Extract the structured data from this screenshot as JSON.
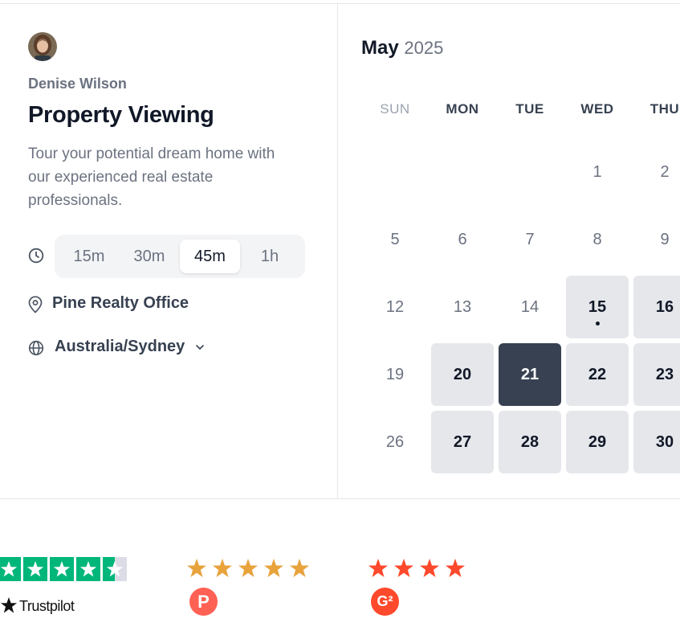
{
  "host": {
    "name": "Denise Wilson"
  },
  "event": {
    "title": "Property Viewing",
    "description": "Tour your potential dream home with our experienced real estate professionals."
  },
  "durations": {
    "options": [
      "15m",
      "30m",
      "45m",
      "1h"
    ],
    "selected": "45m"
  },
  "location": {
    "label": "Pine Realty Office"
  },
  "timezone": {
    "label": "Australia/Sydney"
  },
  "calendar": {
    "month": "May",
    "year": "2025",
    "weekdays": [
      "SUN",
      "MON",
      "TUE",
      "WED",
      "THU"
    ],
    "selected_day": "21",
    "today": "15"
  },
  "reviews": {
    "trustpilot": {
      "name": "Trustpilot",
      "rating": 4.5
    },
    "producthunt": {
      "logo_letter": "P",
      "rating": 5
    },
    "g2": {
      "logo_letter": "G²",
      "rating": 4.5
    }
  },
  "colors": {
    "selected_day": "#374151",
    "available_day": "#e5e7eb",
    "trustpilot_green": "#00b67a",
    "producthunt_orange": "#e8a33d",
    "producthunt_logo": "#ff6154",
    "g2_red": "#ff492c"
  }
}
